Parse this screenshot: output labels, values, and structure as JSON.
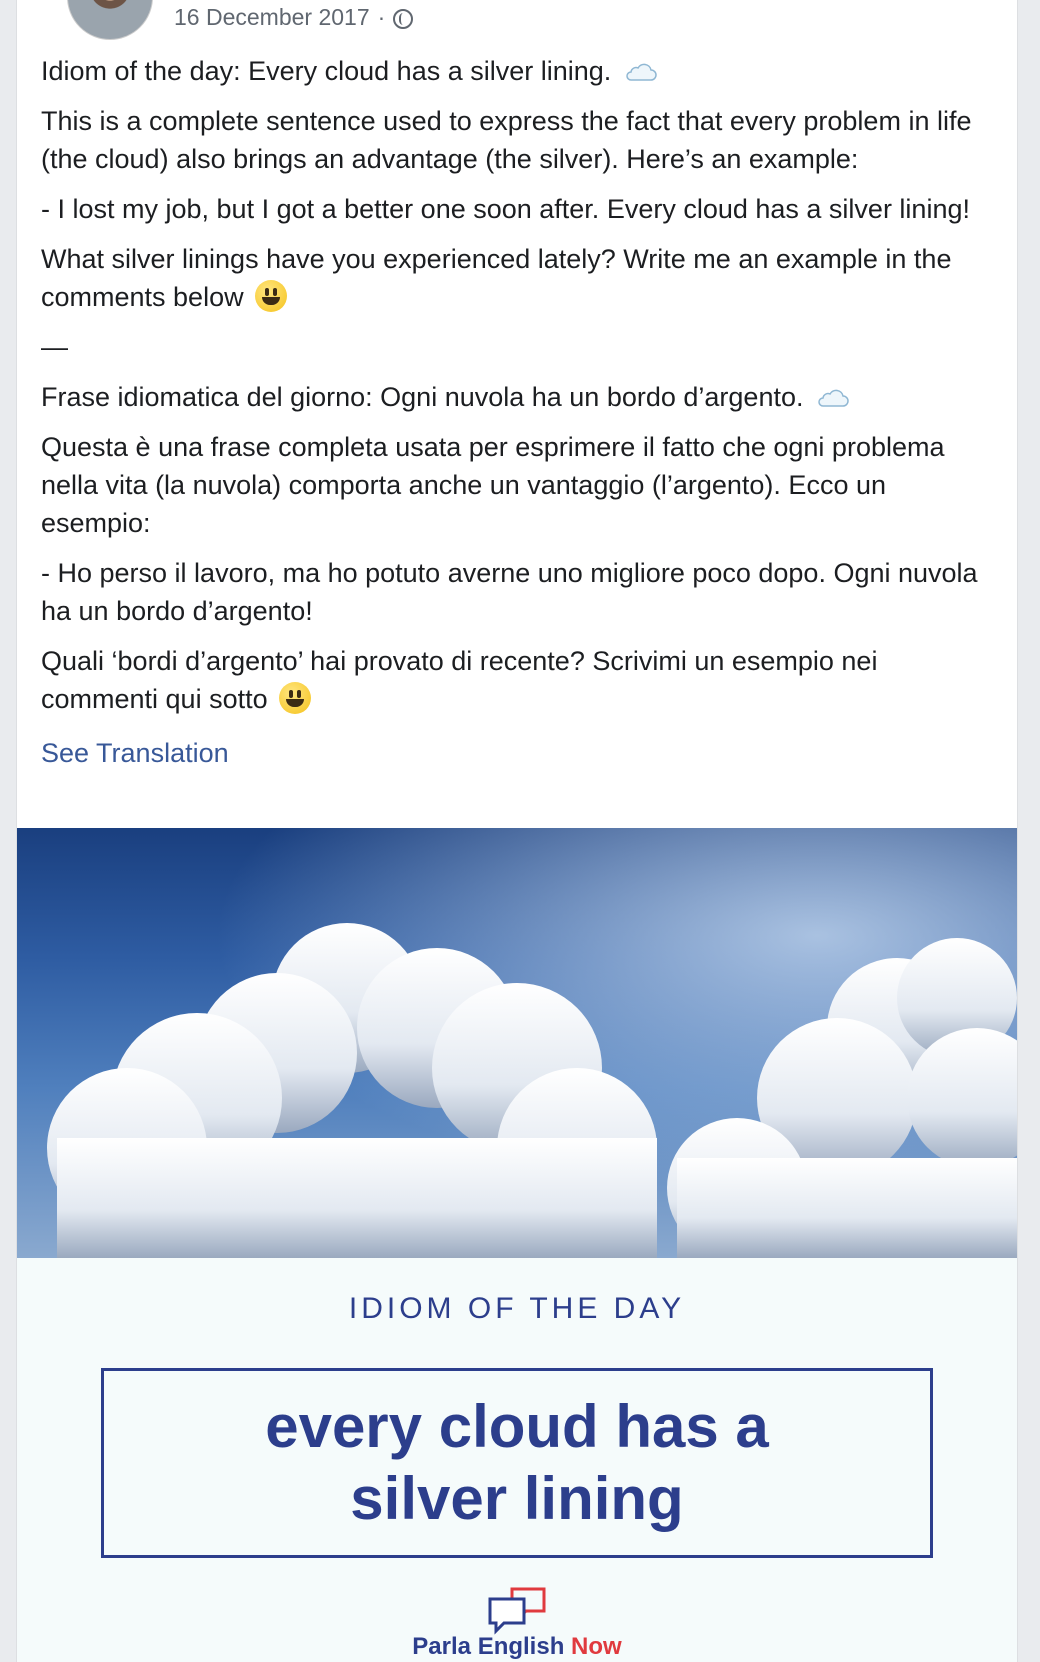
{
  "post": {
    "date": "16 December 2017",
    "separator": "·",
    "privacy_icon": "globe-icon",
    "paragraphs": {
      "p1": "Idiom of the day: Every cloud has a silver lining.",
      "p2": "This is a complete sentence used to express the fact that every problem in life (the cloud) also brings an advantage (the silver). Here’s an example:",
      "p3": "- I lost my job, but I got a better one soon after. Every cloud has a silver lining!",
      "p4": "What silver linings have you experienced lately? Write me an example in the comments below",
      "dash": "—",
      "p5": "Frase idiomatica del giorno: Ogni nuvola ha un bordo d’argento.",
      "p6": "Questa è una frase completa usata per esprimere il fatto che ogni problema nella vita (la nuvola) comporta anche un vantaggio (l’argento). Ecco un esempio:",
      "p7": "- Ho perso il lavoro, ma ho potuto averne uno migliore poco dopo. Ogni nuvola ha un bordo d’argento!",
      "p8": "Quali ‘bordi d’argento’ hai provato di recente? Scrivimi un esempio nei commenti qui sotto"
    },
    "see_translation": "See Translation"
  },
  "promo": {
    "kicker": "IDIOM OF THE DAY",
    "title": "every cloud has a silver lining",
    "logo_part1": "Parla",
    "logo_part2": "English",
    "logo_part3": "Now"
  },
  "colors": {
    "brand_blue": "#2c3e8c",
    "brand_red": "#e03a3e",
    "link": "#385898"
  }
}
